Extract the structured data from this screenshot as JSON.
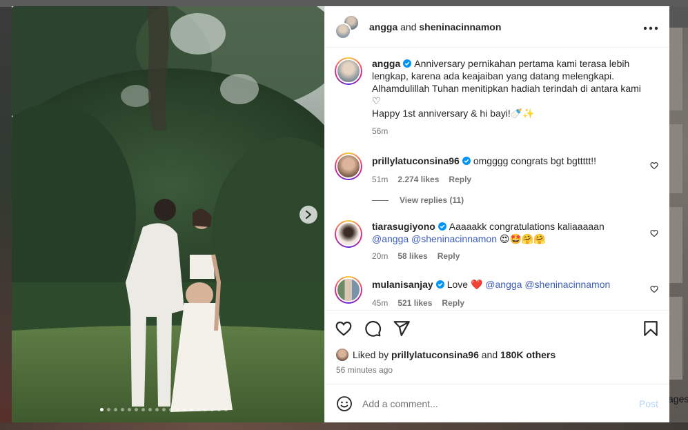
{
  "header": {
    "user1": "angga",
    "joiner": "and",
    "user2": "sheninacinnamon"
  },
  "caption": {
    "username": "angga",
    "line1": "Anniversary pernikahan pertama kami terasa lebih lengkap, karena ada keajaiban yang datang melengkapi. Alhamdulillah Tuhan menitipkan hadiah terindah di antara kami ♡",
    "line2": "Happy 1st anniversary & hi bayi!🍼✨",
    "time": "56m"
  },
  "comments": [
    {
      "username": "prillylatuconsina96",
      "text": "omgggg congrats bgt bgttttt!!",
      "time": "51m",
      "likes": "2.274 likes",
      "reply": "Reply"
    },
    {
      "username": "tiarasugiyono",
      "text": "Aaaaakk congratulations kaliaaaaan",
      "mention1": "@angga",
      "mention2": "@sheninacinnamon",
      "emoji": "😍🤩🤗🤗",
      "time": "20m",
      "likes": "58 likes",
      "reply": "Reply"
    },
    {
      "username": "mulanisanjay",
      "text": "Love ❤️",
      "mention1": "@angga",
      "mention2": "@sheninacinnamon",
      "time": "45m",
      "likes": "521 likes",
      "reply": "Reply"
    }
  ],
  "view_replies": "View replies (11)",
  "likes": {
    "prefix": "Liked by",
    "user": "prillylatuconsina96",
    "joiner": "and",
    "others": "180K others"
  },
  "timestamp": "56 minutes ago",
  "add_comment": {
    "placeholder": "Add a comment...",
    "post_label": "Post"
  },
  "background_text": "ages",
  "carousel": {
    "total": 19,
    "active_index": 0
  },
  "colors": {
    "verified": "#0095f6",
    "mention": "#3b5cb8",
    "post_disabled": "#b3d4f5",
    "heart_red": "#ff3040"
  }
}
